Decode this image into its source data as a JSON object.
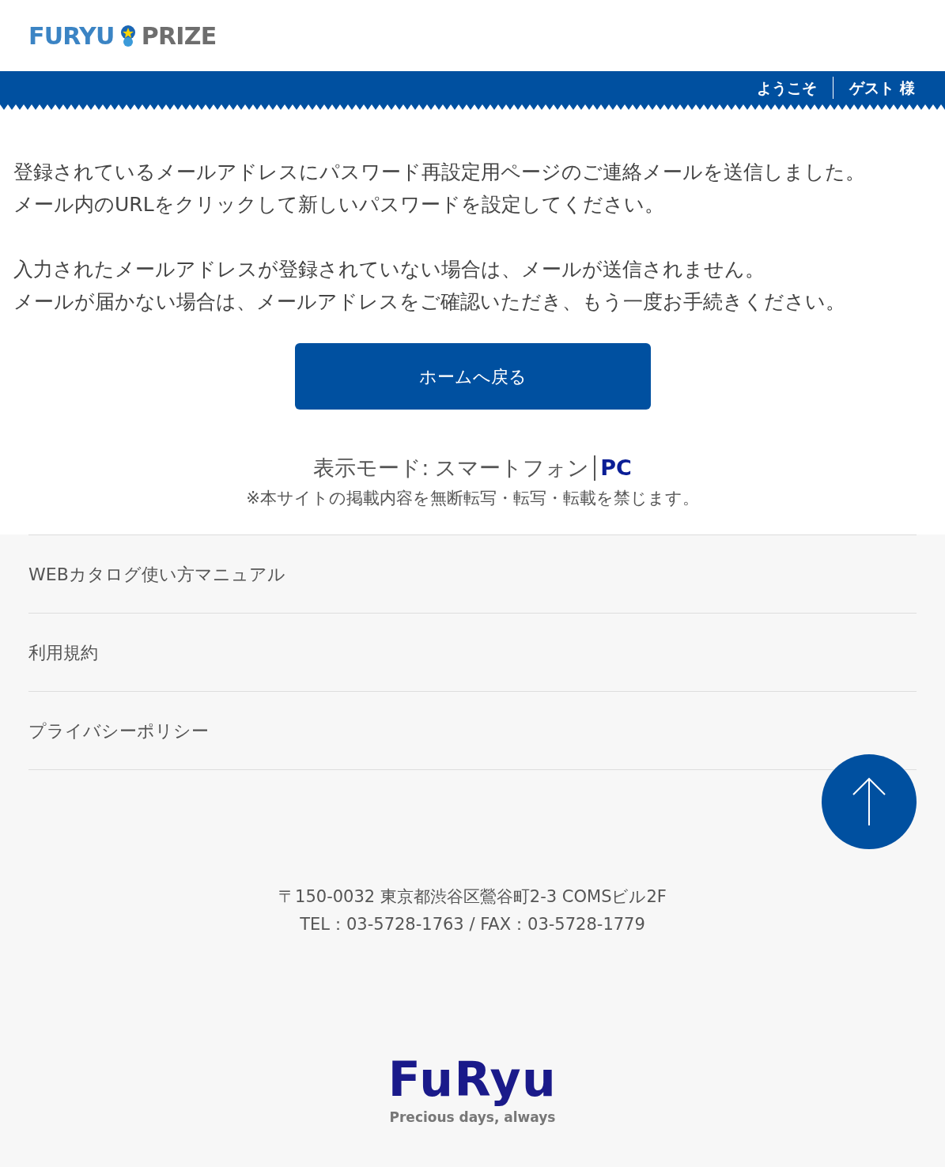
{
  "logo": {
    "left": "FURYU",
    "right": "PRIZE"
  },
  "header": {
    "welcome": "ようこそ",
    "user": "ゲスト 様"
  },
  "message": {
    "paragraphs": [
      [
        "登録されているメールアドレスにパスワード再設定用ページのご連絡メールを送信しました。",
        "メール内のURLをクリックして新しいパスワードを設定してください。"
      ],
      [
        "入力されたメールアドレスが登録されていない場合は、メールが送信されません。",
        "メールが届かない場合は、メールアドレスをご確認いただき、もう一度お手続きください。"
      ]
    ]
  },
  "home_button": "ホームへ戻る",
  "display_mode": {
    "label": "表示モード:",
    "options": [
      {
        "label": "スマートフォン",
        "selected": true
      },
      {
        "label": "PC",
        "selected": false
      }
    ]
  },
  "notice": "※本サイトの掲載内容を無断転写・転写・転載を禁じます。",
  "footer": {
    "links": [
      "WEBカタログ使い方マニュアル",
      "利用規約",
      "プライバシーポリシー"
    ],
    "address": [
      "〒150-0032 東京都渋谷区鶯谷町2-3 COMSビル2F",
      "TEL：03-5728-1763 / FAX：03-5728-1779"
    ],
    "brand": {
      "name": "FuRyu",
      "tagline": "Precious days, always"
    }
  }
}
